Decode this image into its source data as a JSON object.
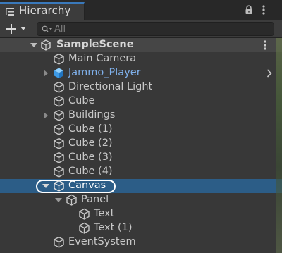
{
  "window": {
    "tab_title": "Hierarchy",
    "tab_icon": "hierarchy-list-icon",
    "lock_icon": "lock-icon",
    "menu_icon": "kebab-menu-icon"
  },
  "toolbar": {
    "add_icon": "plus-icon",
    "search_placeholder": "All",
    "search_value": ""
  },
  "scene": {
    "name": "SampleScene",
    "icon": "unity-logo-icon",
    "expanded": true
  },
  "items": [
    {
      "label": "Main Camera",
      "depth": 1,
      "has_children": false,
      "prefab": false
    },
    {
      "label": "Jammo_Player",
      "depth": 1,
      "has_children": true,
      "expanded": false,
      "prefab": true
    },
    {
      "label": "Directional Light",
      "depth": 1,
      "has_children": false,
      "prefab": false
    },
    {
      "label": "Cube",
      "depth": 1,
      "has_children": false,
      "prefab": false
    },
    {
      "label": "Buildings",
      "depth": 1,
      "has_children": true,
      "expanded": false,
      "prefab": false
    },
    {
      "label": "Cube (1)",
      "depth": 1,
      "has_children": false,
      "prefab": false
    },
    {
      "label": "Cube (2)",
      "depth": 1,
      "has_children": false,
      "prefab": false
    },
    {
      "label": "Cube (3)",
      "depth": 1,
      "has_children": false,
      "prefab": false
    },
    {
      "label": "Cube (4)",
      "depth": 1,
      "has_children": false,
      "prefab": false
    },
    {
      "label": "Canvas",
      "depth": 1,
      "has_children": true,
      "expanded": true,
      "prefab": false,
      "selected": true
    },
    {
      "label": "Panel",
      "depth": 2,
      "has_children": true,
      "expanded": true,
      "prefab": false
    },
    {
      "label": "Text",
      "depth": 3,
      "has_children": false,
      "prefab": false
    },
    {
      "label": "Text (1)",
      "depth": 3,
      "has_children": false,
      "prefab": false
    },
    {
      "label": "EventSystem",
      "depth": 1,
      "has_children": false,
      "prefab": false
    }
  ],
  "colors": {
    "selection": "#2c5d87",
    "prefab_text": "#7fb0ea",
    "tab_accent": "#3a79bb"
  }
}
